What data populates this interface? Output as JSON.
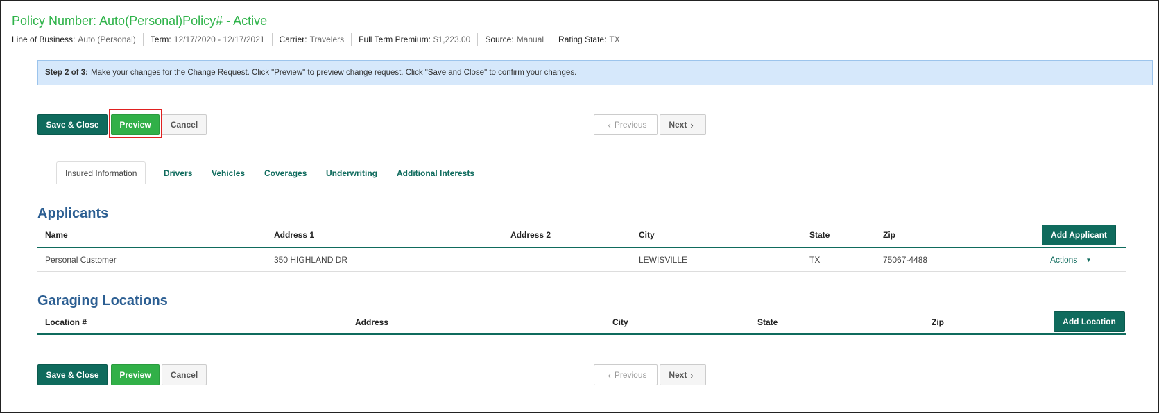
{
  "header": {
    "policy_title": "Policy Number: Auto(Personal)Policy# - Active",
    "meta": [
      {
        "label": "Line of Business:",
        "value": "Auto (Personal)"
      },
      {
        "label": "Term:",
        "value": "12/17/2020 - 12/17/2021"
      },
      {
        "label": "Carrier:",
        "value": "Travelers"
      },
      {
        "label": "Full Term Premium:",
        "value": "$1,223.00"
      },
      {
        "label": "Source:",
        "value": "Manual"
      },
      {
        "label": "Rating State:",
        "value": "TX"
      }
    ]
  },
  "banner": {
    "step": "Step 2 of 3:",
    "text": "Make your changes for the Change Request. Click \"Preview\" to preview change request. Click \"Save and Close\" to confirm your changes."
  },
  "toolbar": {
    "save_close": "Save & Close",
    "preview": "Preview",
    "cancel": "Cancel",
    "previous": "Previous",
    "next": "Next"
  },
  "tabs": [
    {
      "label": "Insured Information",
      "active": true
    },
    {
      "label": "Drivers",
      "active": false
    },
    {
      "label": "Vehicles",
      "active": false
    },
    {
      "label": "Coverages",
      "active": false
    },
    {
      "label": "Underwriting",
      "active": false
    },
    {
      "label": "Additional Interests",
      "active": false
    }
  ],
  "applicants": {
    "title": "Applicants",
    "add_button": "Add Applicant",
    "columns": [
      "Name",
      "Address 1",
      "Address 2",
      "City",
      "State",
      "Zip"
    ],
    "rows": [
      {
        "name": "Personal Customer",
        "address1": "350 HIGHLAND DR",
        "address2": "",
        "city": "LEWISVILLE",
        "state": "TX",
        "zip": "75067-4488",
        "actions": "Actions"
      }
    ]
  },
  "garaging": {
    "title": "Garaging Locations",
    "add_button": "Add Location",
    "columns": [
      "Location #",
      "Address",
      "City",
      "State",
      "Zip"
    ]
  },
  "icons": {
    "chevron_left": "chevron-left-icon",
    "chevron_right": "chevron-right-icon",
    "caret_down": "caret-down-icon"
  },
  "colors": {
    "title_green": "#2fb34a",
    "primary": "#0f6b5d",
    "preview_green": "#31b048",
    "section_blue": "#2b5e92",
    "banner_bg": "#d6e8fb",
    "highlight_red": "#e02020"
  }
}
